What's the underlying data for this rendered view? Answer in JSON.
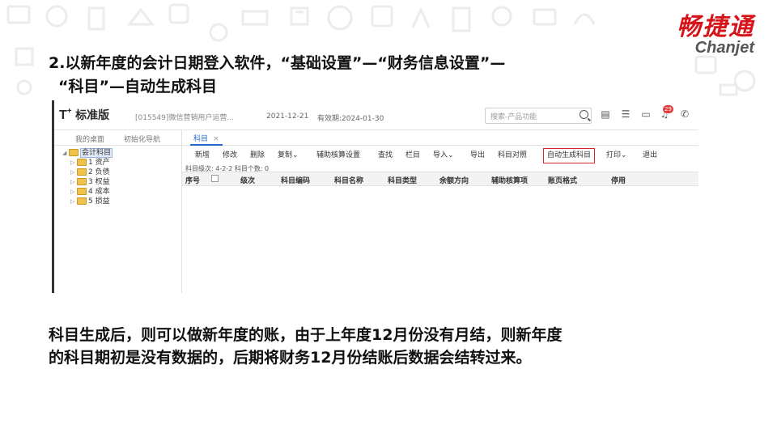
{
  "logo": {
    "cn": "畅捷通",
    "en": "Chanjet"
  },
  "heading": {
    "line1": "2.以新年度的会计日期登入软件，“基础设置”—“财务信息设置”—",
    "line2": "“科目”—自动生成科目"
  },
  "app": {
    "product": {
      "prefix": "T",
      "plus": "+",
      "name": "标准版"
    },
    "tenant": "[015549]微信营销用户运营...",
    "date": "2021-12-21",
    "valid": "有效期:2024-01-30",
    "search": {
      "placeholder": "搜索-产品功能"
    },
    "badge": "29",
    "nav": [
      "我的桌面",
      "初始化导航"
    ],
    "tab": {
      "label": "科目",
      "close": "×"
    },
    "tree": {
      "root": "会计科目",
      "children": [
        "1 资产",
        "2 负债",
        "3 权益",
        "4 成本",
        "5 损益"
      ]
    },
    "toolbar": [
      "新增",
      "修改",
      "删除",
      "复制",
      "辅助核算设置",
      "查找",
      "栏目",
      "导入",
      "导出",
      "科目对照",
      "自动生成科目",
      "打印",
      "退出"
    ],
    "info": "科目级次:  4-2-2   科目个数:  0",
    "columns": [
      "序号",
      "级次",
      "科目编码",
      "科目名称",
      "科目类型",
      "余额方向",
      "辅助核算项",
      "账页格式",
      "停用"
    ]
  },
  "body": {
    "line1": "科目生成后，则可以做新年度的账，由于上年度12月份没有月结，则新年度",
    "line2": "的科目期初是没有数据的，后期将财务12月份结账后数据会结转过来。"
  },
  "colors": {
    "brand": "#d7141a",
    "highlight": "#d6252b",
    "tab": "#2668c9"
  }
}
